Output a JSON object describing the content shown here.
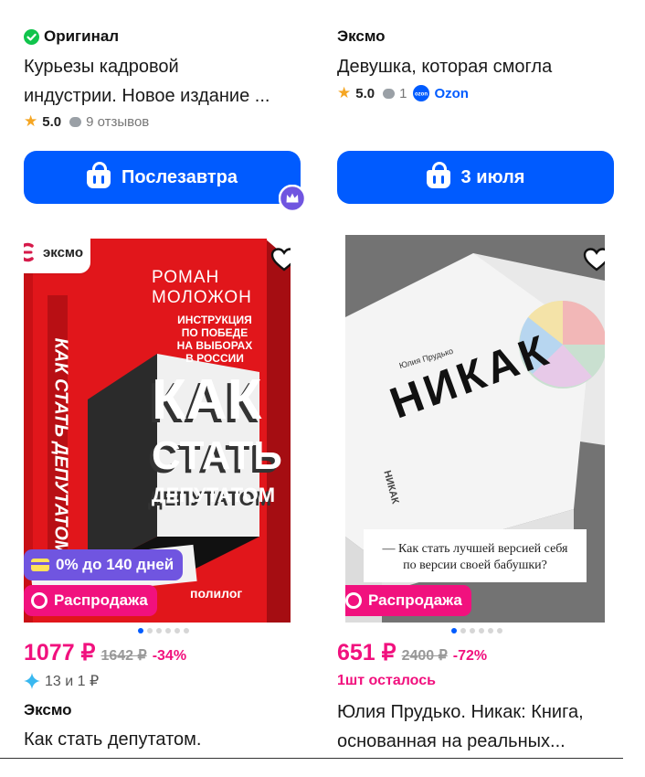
{
  "colors": {
    "accent": "#005bff",
    "sale": "#f1117e",
    "credit": "#7055e0",
    "check": "#10c44c"
  },
  "cards": [
    {
      "seller": "Оригинал",
      "seller_icon": "check-badge-icon",
      "title_lines": [
        "Курьезы кадровой",
        "индустрии. Новое издание ..."
      ],
      "rating": "5.0",
      "reviews": "9 отзывов",
      "delivery": "Послезавтра",
      "image": {
        "publisher_logo": "ЭКСМО",
        "author": "РОМАН МОЛОЖОН",
        "subtitle_lines": [
          "ИНСТРУКЦИЯ",
          "ПО ПОБЕДЕ",
          "НА ВЫБОРАХ",
          "В РОССИИ"
        ],
        "title_lines": [
          "КАК",
          "СТАТЬ",
          "ДЕПУТАТОМ"
        ],
        "spine": "КАК СТАТЬ ДЕПУТАТОМ",
        "imprint": "полилог"
      },
      "installment": "0% до 140 дней",
      "sale_badge": "Распродажа",
      "price": "1077 ₽",
      "old_price": "1642 ₽",
      "discount": "-34%",
      "bonus": "13 и 1 ₽",
      "brand": "Эксмо",
      "name_line": "Как стать депутатом."
    },
    {
      "seller": "Эксмо",
      "title_lines": [
        "Девушка, которая смогла"
      ],
      "rating": "5.0",
      "reviews": "1",
      "store": "Ozon",
      "store_logo": "ozon",
      "delivery": "3 июля",
      "image": {
        "author": "Юлия Прудько",
        "title": "НИКАК",
        "spine": "НИКАК",
        "tagline_lines": [
          "— Как стать лучшей версией себя",
          "по версии своей бабушки?"
        ]
      },
      "sale_badge": "Распродажа",
      "price": "651 ₽",
      "old_price": "2400 ₽",
      "discount": "-72%",
      "stock": "1шт осталось",
      "name_lines": [
        "Юлия Прудько. Никак: Книга,",
        "основанная на реальных..."
      ]
    }
  ]
}
